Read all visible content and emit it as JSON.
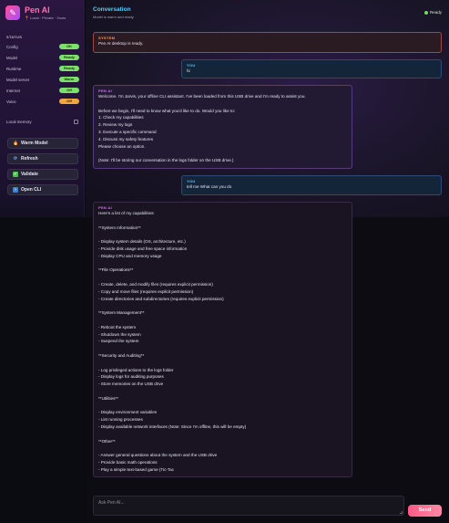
{
  "brand": {
    "title": "Pen AI",
    "subtitle": "Local · Private · Yours"
  },
  "status": {
    "title": "STATUS",
    "rows": [
      {
        "label": "Config",
        "value": "OK",
        "tone": "ok"
      },
      {
        "label": "Model",
        "value": "Ready",
        "tone": "ok"
      },
      {
        "label": "Runtime",
        "value": "Ready",
        "tone": "ok"
      },
      {
        "label": "Model server",
        "value": "Warm",
        "tone": "ok"
      },
      {
        "label": "Internet",
        "value": "Off",
        "tone": "ok"
      },
      {
        "label": "Voice",
        "value": "Off",
        "tone": "warn"
      }
    ]
  },
  "memory": {
    "label": "Local memory",
    "checked": false
  },
  "actions": {
    "warm_model": "Warm Model",
    "refresh": "Refresh",
    "validate": "Validate",
    "open_cli": "Open CLI"
  },
  "header": {
    "title": "Conversation",
    "subtitle": "Model is warm and ready.",
    "status": "Ready"
  },
  "messages": [
    {
      "role": "SYSTEM",
      "text": "Pen AI desktop is ready."
    },
    {
      "role": "YOU",
      "text": "hi"
    },
    {
      "role": "PEN AI",
      "text": "Welcome. I'm Jarvis, your offline CLI assistant. I've been loaded from this USB drive and I'm ready to assist you.\n\nBefore we begin, I'll need to know what you'd like to do. Would you like to:\n1. Check my capabilities\n2. Review my logs\n3. Execute a specific command\n4. Discuss my safety features\nPlease choose an option.\n\n(Note: I'll be storing our conversation in the logs folder on the USB drive.)"
    },
    {
      "role": "YOU",
      "text": "tell me What can you do"
    },
    {
      "role": "PEN AI",
      "text": "Here's a list of my capabilities:\n\n**System Information**\n\n- Display system details (OS, architecture, etc.)\n- Provide disk usage and free space information\n- Display CPU and memory usage\n\n**File Operations**\n\n- Create, delete, and modify files (requires explicit permission)\n- Copy and move files (requires explicit permission)\n- Create directories and subdirectories (requires explicit permission)\n\n**System Management**\n\n- Reboot the system\n- Shutdown the system\n- Suspend the system\n\n**Security and Auditing**\n\n- Log privileged actions to the logs folder\n- Display logs for auditing purposes\n- Store memories on the USB drive\n\n**Utilities**\n\n- Display environment variables\n- List running processes\n- Display available network interfaces (Note: Since I'm offline, this will be empty)\n\n**Other**\n\n- Answer general questions about the system and the USB drive\n- Provide basic math operations\n- Play a simple text-based game (Tic-Tac"
    }
  ],
  "composer": {
    "placeholder": "Ask Pen AI...",
    "send_label": "Send"
  }
}
